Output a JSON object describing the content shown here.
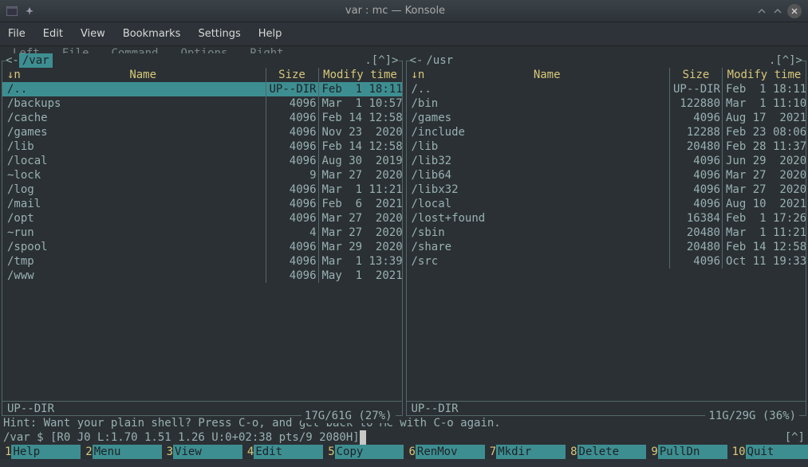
{
  "window": {
    "title": "var : mc — Konsole"
  },
  "konsole_menu": [
    "File",
    "Edit",
    "View",
    "Bookmarks",
    "Settings",
    "Help"
  ],
  "mc_menu": [
    "Left",
    "File",
    "Command",
    "Options",
    "Right"
  ],
  "left_panel": {
    "path": "/var",
    "left_deco": "<-",
    "right_deco": ".[^]>",
    "sort_indicator": "↓n",
    "headers": {
      "name": "Name",
      "size": "Size",
      "mtime": "Modify time"
    },
    "rows": [
      {
        "name": "/..",
        "size": "UP--DIR",
        "mtime": "Feb  1 18:11",
        "selected": true
      },
      {
        "name": "/backups",
        "size": "4096",
        "mtime": "Mar  1 10:57"
      },
      {
        "name": "/cache",
        "size": "4096",
        "mtime": "Feb 14 12:58"
      },
      {
        "name": "/games",
        "size": "4096",
        "mtime": "Nov 23  2020"
      },
      {
        "name": "/lib",
        "size": "4096",
        "mtime": "Feb 14 12:58"
      },
      {
        "name": "/local",
        "size": "4096",
        "mtime": "Aug 30  2019"
      },
      {
        "name": "~lock",
        "size": "9",
        "mtime": "Mar 27  2020"
      },
      {
        "name": "/log",
        "size": "4096",
        "mtime": "Mar  1 11:21"
      },
      {
        "name": "/mail",
        "size": "4096",
        "mtime": "Feb  6  2021"
      },
      {
        "name": "/opt",
        "size": "4096",
        "mtime": "Mar 27  2020"
      },
      {
        "name": "~run",
        "size": "4",
        "mtime": "Mar 27  2020"
      },
      {
        "name": "/spool",
        "size": "4096",
        "mtime": "Mar 29  2020"
      },
      {
        "name": "/tmp",
        "size": "4096",
        "mtime": "Mar  1 13:39"
      },
      {
        "name": "/www",
        "size": "4096",
        "mtime": "May  1  2021"
      }
    ],
    "status": "UP--DIR",
    "footer": "17G/61G (27%)"
  },
  "right_panel": {
    "path": "/usr",
    "left_deco": "<-",
    "right_deco": ".[^]>",
    "sort_indicator": "↓n",
    "headers": {
      "name": "Name",
      "size": "Size",
      "mtime": "Modify time"
    },
    "rows": [
      {
        "name": "/..",
        "size": "UP--DIR",
        "mtime": "Feb  1 18:11"
      },
      {
        "name": "/bin",
        "size": "122880",
        "mtime": "Mar  1 11:10"
      },
      {
        "name": "/games",
        "size": "4096",
        "mtime": "Aug 17  2021"
      },
      {
        "name": "/include",
        "size": "12288",
        "mtime": "Feb 23 08:06"
      },
      {
        "name": "/lib",
        "size": "20480",
        "mtime": "Feb 28 11:37"
      },
      {
        "name": "/lib32",
        "size": "4096",
        "mtime": "Jun 29  2020"
      },
      {
        "name": "/lib64",
        "size": "4096",
        "mtime": "Mar 27  2020"
      },
      {
        "name": "/libx32",
        "size": "4096",
        "mtime": "Mar 27  2020"
      },
      {
        "name": "/local",
        "size": "4096",
        "mtime": "Aug 10  2021"
      },
      {
        "name": "/lost+found",
        "size": "16384",
        "mtime": "Feb  1 17:26"
      },
      {
        "name": "/sbin",
        "size": "20480",
        "mtime": "Mar  1 11:21"
      },
      {
        "name": "/share",
        "size": "20480",
        "mtime": "Feb 14 12:58"
      },
      {
        "name": "/src",
        "size": "4096",
        "mtime": "Oct 11 19:33"
      }
    ],
    "status": "UP--DIR",
    "footer": "11G/29G (36%)"
  },
  "hint": "Hint: Want your plain shell? Press C-o, and get back to MC with C-o again.",
  "prompt": {
    "left": "/var $ [R0 J0 L:1.70 1.51 1.26 U:0+02:38 pts/9 2080H]",
    "right": "[^]"
  },
  "fkeys": [
    {
      "n": "1",
      "label": "Help"
    },
    {
      "n": "2",
      "label": "Menu"
    },
    {
      "n": "3",
      "label": "View"
    },
    {
      "n": "4",
      "label": "Edit"
    },
    {
      "n": "5",
      "label": "Copy"
    },
    {
      "n": "6",
      "label": "RenMov"
    },
    {
      "n": "7",
      "label": "Mkdir"
    },
    {
      "n": "8",
      "label": "Delete"
    },
    {
      "n": "9",
      "label": "PullDn"
    },
    {
      "n": "10",
      "label": "Quit"
    }
  ]
}
